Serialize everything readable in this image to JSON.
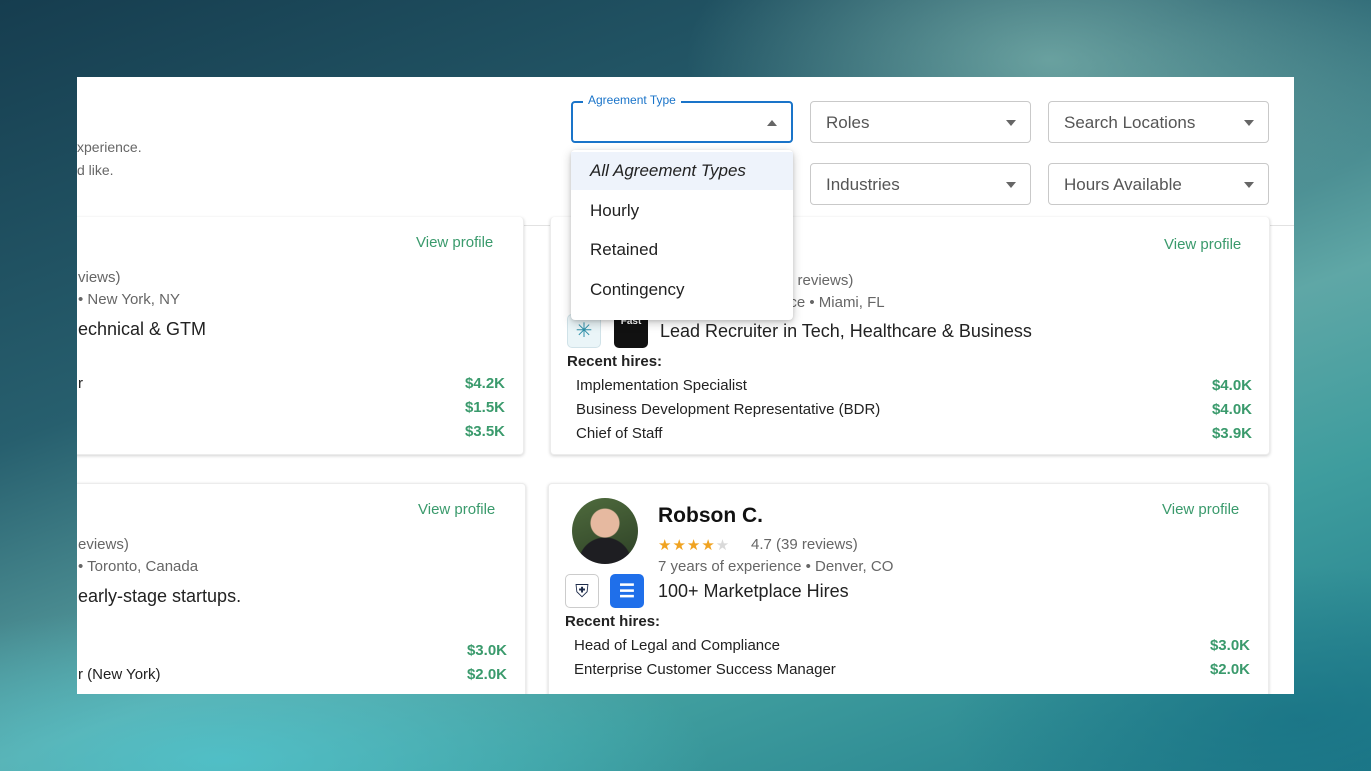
{
  "header": {
    "intro_line1": "xperience.",
    "intro_line2": "d like."
  },
  "filters": {
    "agreement_type": {
      "label": "Agreement Type",
      "value": ""
    },
    "roles": "Roles",
    "search_locations": "Search Locations",
    "industries": "Industries",
    "hours_available": "Hours Available"
  },
  "agreement_menu": {
    "options": [
      "All Agreement Types",
      "Hourly",
      "Retained",
      "Contingency"
    ]
  },
  "cards": {
    "c1": {
      "view_profile": "View profile",
      "reviews": "views)",
      "meta": "• New York, NY",
      "headline": "echnical & GTM",
      "hires": [
        {
          "role": "r",
          "price": "$4.2K"
        },
        {
          "role": "",
          "price": "$1.5K"
        },
        {
          "role": "",
          "price": "$3.5K"
        }
      ]
    },
    "c2": {
      "view_profile": "View profile",
      "reviews": "5 reviews)",
      "meta": "nce • Miami, FL",
      "logo_fast": "Fast",
      "headline": "Lead Recruiter in Tech, Healthcare & Business",
      "recent_label": "Recent hires:",
      "hires": [
        {
          "role": "Implementation Specialist",
          "price": "$4.0K"
        },
        {
          "role": "Business Development Representative (BDR)",
          "price": "$4.0K"
        },
        {
          "role": "Chief of Staff",
          "price": "$3.9K"
        }
      ]
    },
    "c3": {
      "view_profile": "View profile",
      "reviews": "eviews)",
      "meta": "• Toronto, Canada",
      "headline": "early-stage startups.",
      "hires": [
        {
          "role": "",
          "price": "$3.0K"
        },
        {
          "role": "r (New York)",
          "price": "$2.0K"
        }
      ]
    },
    "c4": {
      "view_profile": "View profile",
      "name": "Robson C.",
      "rating": 4.7,
      "rating_text": "4.7 (39 reviews)",
      "meta": "7 years of experience • Denver, CO",
      "headline": "100+ Marketplace Hires",
      "recent_label": "Recent hires:",
      "hires": [
        {
          "role": "Head of Legal and Compliance",
          "price": "$3.0K"
        },
        {
          "role": "Enterprise Customer Success Manager",
          "price": "$2.0K"
        }
      ]
    }
  },
  "colors": {
    "accent_green": "#3a9a6c",
    "focus_blue": "#1a74c9",
    "star": "#f0a321"
  }
}
